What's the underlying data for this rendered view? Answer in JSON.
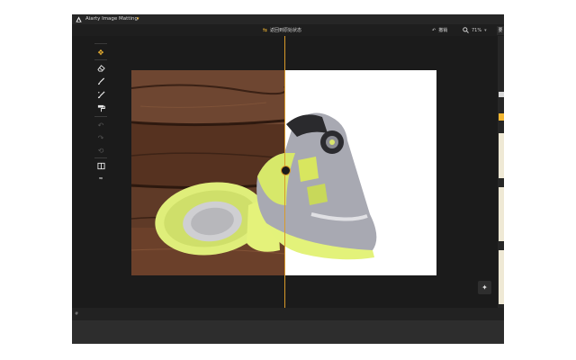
{
  "window": {
    "title": "Aiarty Image Matting",
    "menu_icon": "chevron-down-icon"
  },
  "topbar": {
    "back_to_original": "返回到原始状态",
    "undo": "撤销",
    "zoom": "71%"
  },
  "right_panel": {
    "tab_label": "要"
  },
  "toolbar": {
    "tools": [
      {
        "name": "move-tool",
        "icon": "move-icon",
        "state": "active"
      },
      {
        "name": "erase-tool",
        "icon": "eraser-icon",
        "state": "enabled"
      },
      {
        "name": "brush-tool",
        "icon": "brush-icon",
        "state": "enabled"
      },
      {
        "name": "restore-brush-tool",
        "icon": "magic-brush-icon",
        "state": "enabled"
      },
      {
        "name": "paint-roller-tool",
        "icon": "paint-roller-icon",
        "state": "enabled"
      },
      {
        "name": "undo-tool",
        "icon": "undo-icon",
        "state": "disabled"
      },
      {
        "name": "redo-tool",
        "icon": "redo-icon",
        "state": "disabled"
      },
      {
        "name": "reset-tool",
        "icon": "reset-icon",
        "state": "disabled"
      },
      {
        "name": "compare-tool",
        "icon": "compare-icon",
        "state": "enabled"
      },
      {
        "name": "collapse-tool",
        "icon": "double-chevron-icon",
        "state": "enabled"
      }
    ]
  },
  "canvas": {
    "split_position": 0.5
  },
  "bottom": {
    "hash": "#"
  },
  "colors": {
    "accent": "#f2b632",
    "background": "#1b1b1b",
    "wood": "#5a3522",
    "sole": "#e4f27a"
  }
}
